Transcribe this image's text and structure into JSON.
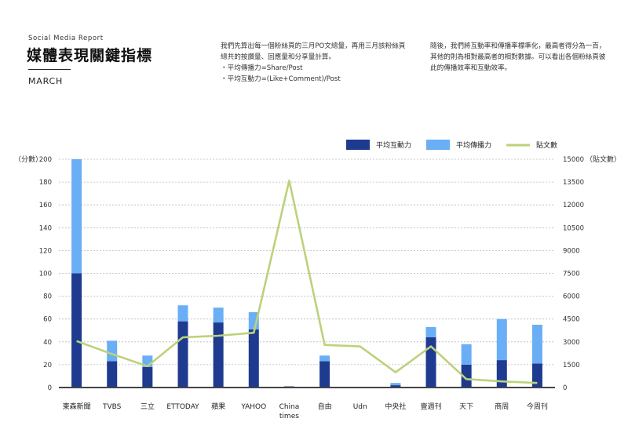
{
  "header": {
    "kicker": "Social Media Report",
    "title": "媒體表現關鍵指標",
    "month": "MARCH"
  },
  "intro": {
    "paragraph1": "我們先算出每一個粉絲頁的三月PO文總量，再用三月該粉絲頁總共的按讚量、回應量和分享量計算。",
    "bullet1": "・平均傳播力=Share/Post",
    "bullet2": "・平均互動力=(Like+Comment)/Post",
    "paragraph2": "隨後，我們將互動率和傳播率標準化，最高者得分為一百，其他的則為相對最高者的相對數據。可以看出各個粉絲頁彼此的傳播效率和互動效率。"
  },
  "chart_data": {
    "type": "bar",
    "stacked": true,
    "categories": [
      "東森新聞",
      "TVBS",
      "三立",
      "ETTODAY",
      "蘋果",
      "YAHOO",
      "China times",
      "自由",
      "Udn",
      "中央社",
      "壹週刊",
      "天下",
      "商周",
      "今周刊"
    ],
    "series": [
      {
        "name": "平均互動力",
        "type": "bar",
        "axis": "left",
        "color": "#1f3b8f",
        "values": [
          100,
          23,
          18,
          58,
          57,
          51,
          1,
          23,
          0,
          2,
          44,
          20,
          24,
          21
        ]
      },
      {
        "name": "平均傳播力",
        "type": "bar",
        "axis": "left",
        "color": "#6aaef5",
        "values": [
          100,
          18,
          10,
          14,
          13,
          15,
          0,
          5,
          0,
          2,
          9,
          18,
          36,
          34
        ]
      },
      {
        "name": "貼文數",
        "type": "line",
        "axis": "right",
        "color": "#bcd27a",
        "values": [
          3050,
          2200,
          1400,
          3300,
          3400,
          3600,
          13600,
          2800,
          2700,
          1000,
          2700,
          550,
          400,
          300
        ]
      }
    ],
    "ylabel": "（分數）",
    "y2label": "（貼文數）",
    "ylim": [
      0,
      200
    ],
    "y2lim": [
      0,
      15000
    ],
    "yticks": [
      "0",
      "20",
      "40",
      "60",
      "80",
      "100",
      "120",
      "140",
      "160",
      "180",
      "200"
    ],
    "y2ticks": [
      "0",
      "1500",
      "3000",
      "4500",
      "6000",
      "7500",
      "9000",
      "10500",
      "12000",
      "13500",
      "15000"
    ],
    "grid": true,
    "legend_position": "top-right"
  }
}
